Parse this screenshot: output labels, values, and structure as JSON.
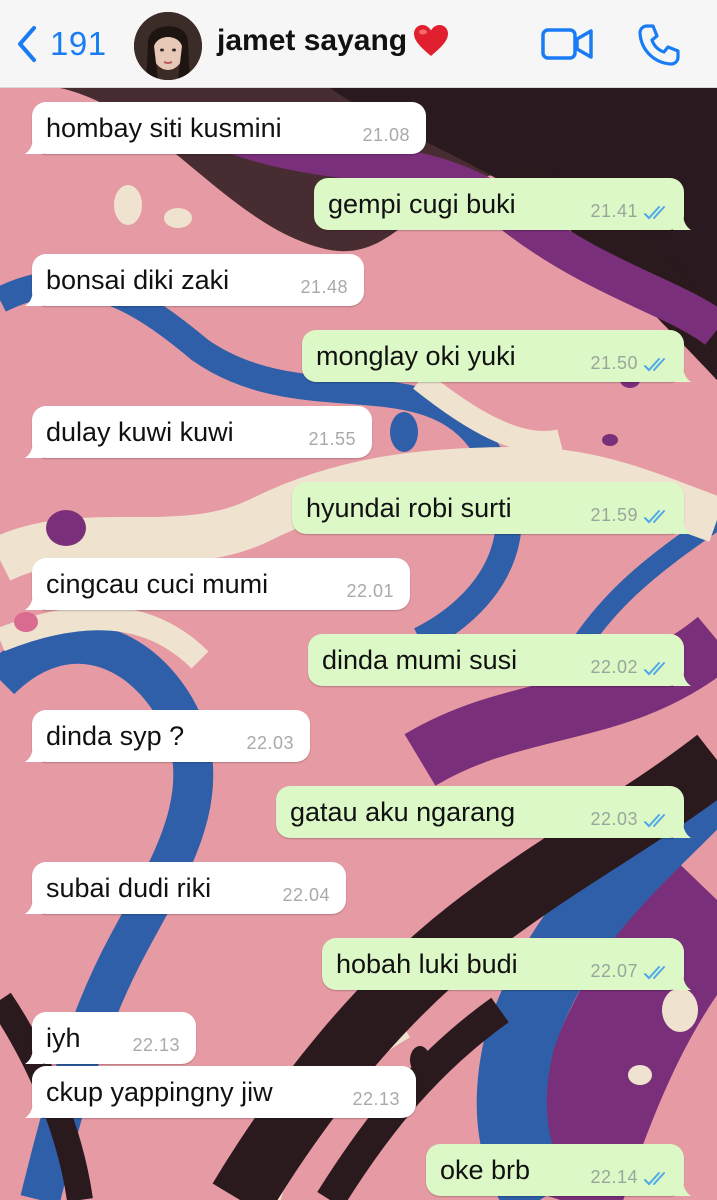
{
  "header": {
    "back_count": "191",
    "contact_name": "jamet sayang"
  },
  "messages": [
    {
      "dir": "in",
      "text": "hombay siti kusmini",
      "time": "21.08"
    },
    {
      "dir": "out",
      "text": "gempi cugi buki",
      "time": "21.41"
    },
    {
      "dir": "in",
      "text": "bonsai diki zaki",
      "time": "21.48"
    },
    {
      "dir": "out",
      "text": "monglay oki yuki",
      "time": "21.50"
    },
    {
      "dir": "in",
      "text": "dulay kuwi kuwi",
      "time": "21.55"
    },
    {
      "dir": "out",
      "text": "hyundai robi surti",
      "time": "21.59"
    },
    {
      "dir": "in",
      "text": "cingcau cuci mumi",
      "time": "22.01"
    },
    {
      "dir": "out",
      "text": "dinda mumi susi",
      "time": "22.02"
    },
    {
      "dir": "in",
      "text": "dinda syp ?",
      "time": "22.03"
    },
    {
      "dir": "out",
      "text": "gatau aku ngarang",
      "time": "22.03"
    },
    {
      "dir": "in",
      "text": "subai dudi riki",
      "time": "22.04"
    },
    {
      "dir": "out",
      "text": "hobah luki budi",
      "time": "22.07"
    },
    {
      "dir": "in",
      "text": "iyh",
      "time": "22.13"
    },
    {
      "dir": "in",
      "text": "ckup yappingny jiw",
      "time": "22.13"
    },
    {
      "dir": "out",
      "text": "oke brb",
      "time": "22.14"
    }
  ],
  "colors": {
    "accent": "#1a7cf5",
    "bubble_out": "#dcf8c6",
    "bubble_in": "#ffffff",
    "read_ticks": "#4fa8e8"
  },
  "icons": {
    "back": "chevron-left-icon",
    "video": "video-camera-icon",
    "call": "phone-icon",
    "name_emoji": "red-heart-emoji",
    "status": "double-check-icon"
  }
}
